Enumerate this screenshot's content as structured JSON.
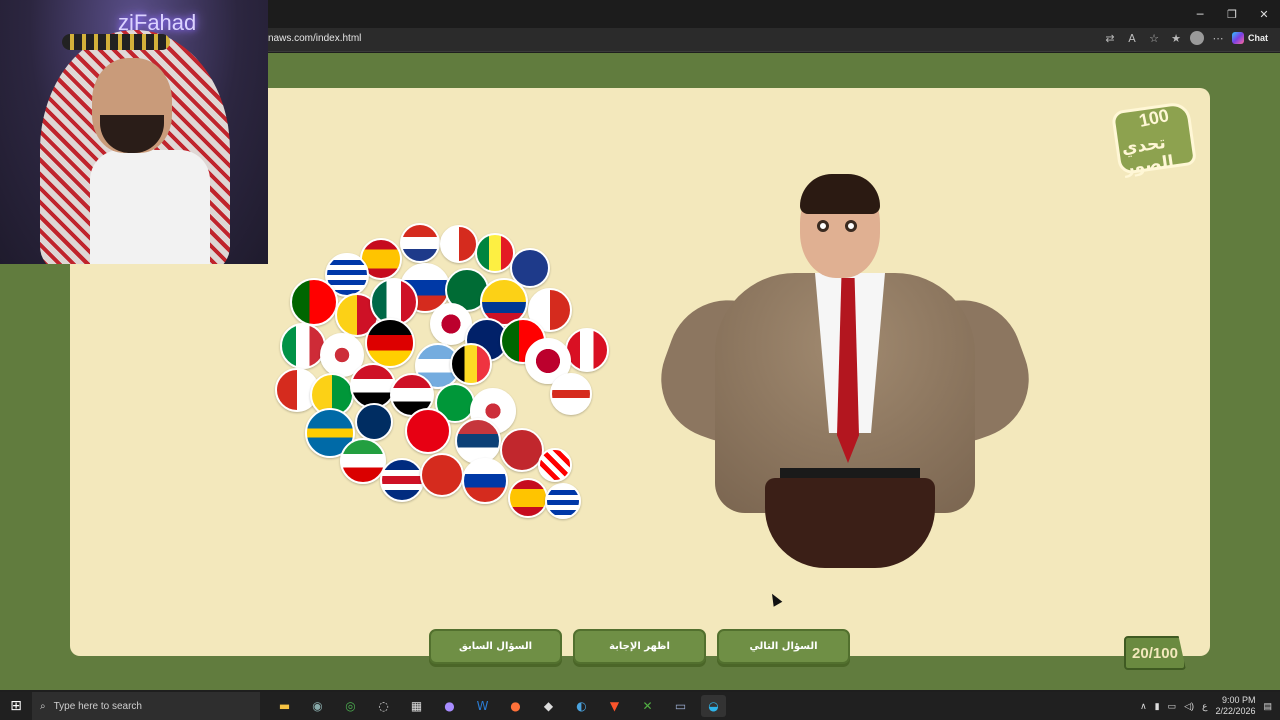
{
  "browser": {
    "url": "naws.com/index.html",
    "chat_label": "Chat",
    "window_controls": {
      "minimize": "─",
      "restore": "❐",
      "close": "✕"
    }
  },
  "stream_overlay": {
    "channel_sign": "ziFahad"
  },
  "game": {
    "logo_number": "100",
    "logo_text": "تحدي الصور",
    "buttons": {
      "previous": "السؤال السابق",
      "show_answer": "اظهر الإجابة",
      "next": "السؤال التالي"
    },
    "counter": "20/100"
  },
  "taskbar": {
    "search_placeholder": "Type here to search",
    "apps": [
      "file-explorer",
      "app-2",
      "chrome",
      "app-4",
      "store",
      "app-6",
      "word",
      "firefox",
      "app-9",
      "steam",
      "brave",
      "xbox",
      "app-13",
      "edge"
    ],
    "time": "9:00 PM",
    "date": "2/22/2026",
    "lang": "ع"
  },
  "colors": {
    "page_green": "#617c3e",
    "card_cream": "#f3e8bc",
    "button_green": "#6f8f45"
  }
}
